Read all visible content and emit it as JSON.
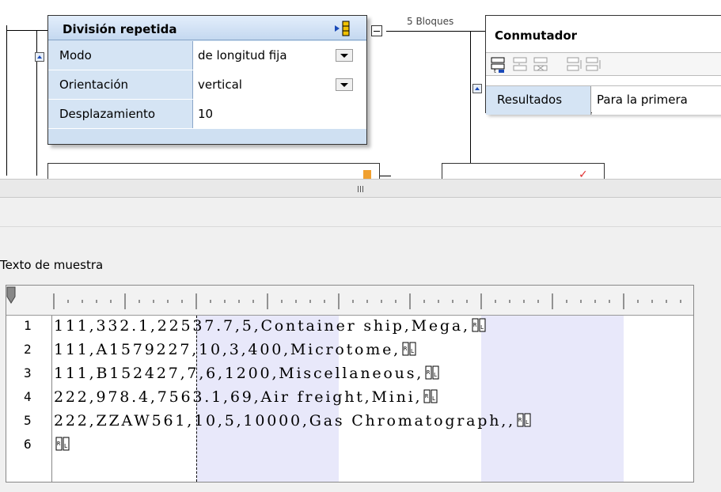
{
  "split_box": {
    "title": "División repetida",
    "rows": [
      {
        "label": "Modo",
        "value": "de longitud fija"
      },
      {
        "label": "Orientación",
        "value": "vertical"
      },
      {
        "label": "Desplazamiento",
        "value": "10"
      }
    ]
  },
  "connector": {
    "blocks_label": "5 Bloques"
  },
  "switch_box": {
    "title": "Conmutador",
    "result_label": "Resultados",
    "result_value": "Para la primera"
  },
  "splitter": {
    "grip_icon": "grip-icon"
  },
  "sample": {
    "title": "Texto de muestra",
    "lines": [
      {
        "num": "1",
        "text": "111,332.1,22537.7,5,Container ship,Mega,"
      },
      {
        "num": "2",
        "text": "111,A1579227,10,3,400,Microtome,"
      },
      {
        "num": "3",
        "text": "111,B152427,7,6,1200,Miscellaneous,"
      },
      {
        "num": "4",
        "text": "222,978.4,7563.1,69,Air freight,Mini,"
      },
      {
        "num": "5",
        "text": "222,ZZAW561,10,5,10000,Gas Chromatograph,,"
      },
      {
        "num": "6",
        "text": ""
      }
    ],
    "eol_icon": "crlf-icon"
  },
  "colors": {
    "box_blue": "#cfe0f2",
    "label_blue": "#d5e4f4",
    "column_shade": "#e8e8fa",
    "pane_gray": "#f0f0f0"
  }
}
